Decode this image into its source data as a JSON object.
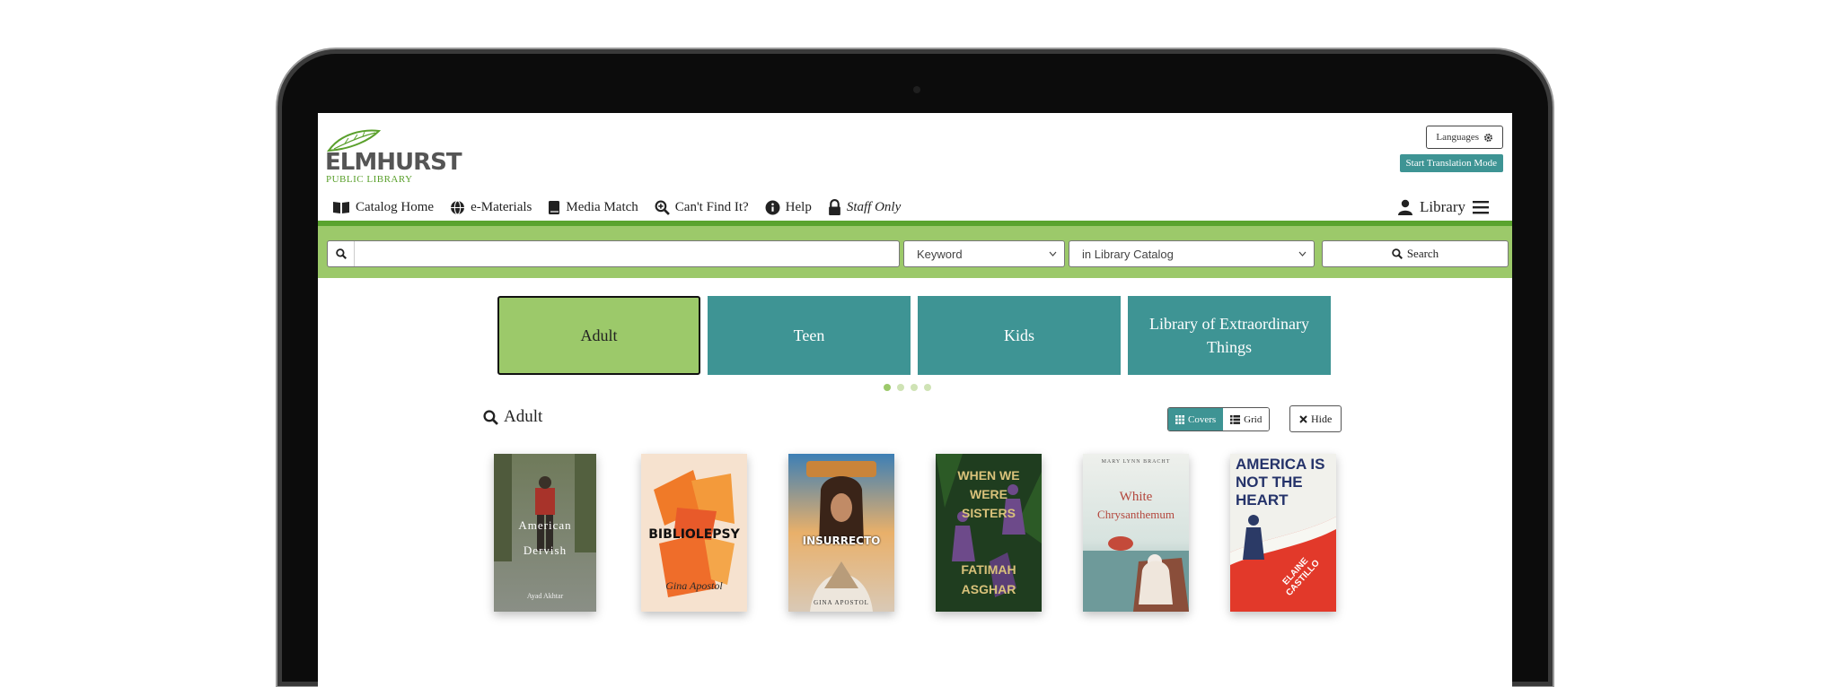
{
  "header": {
    "logo_main": "ELMHURST",
    "logo_sub": "PUBLIC LIBRARY",
    "languages_label": "Languages",
    "translation_label": "Start Translation Mode"
  },
  "nav": {
    "items": [
      {
        "label": "Catalog Home",
        "icon": "book-open-icon"
      },
      {
        "label": "e-Materials",
        "icon": "globe-icon"
      },
      {
        "label": "Media Match",
        "icon": "book-icon"
      },
      {
        "label": "Can't Find It?",
        "icon": "search-plus-icon"
      },
      {
        "label": "Help",
        "icon": "info-icon"
      },
      {
        "label": "Staff Only",
        "icon": "lock-icon"
      }
    ],
    "account_label": "Library"
  },
  "search": {
    "placeholder": "",
    "type_selected": "Keyword",
    "scope_selected": "in Library Catalog",
    "button_label": "Search"
  },
  "tiles": [
    {
      "label": "Adult",
      "active": true
    },
    {
      "label": "Teen",
      "active": false
    },
    {
      "label": "Kids",
      "active": false
    },
    {
      "label": "Library of Extraordinary Things",
      "active": false
    }
  ],
  "results": {
    "title": "Adult",
    "covers_label": "Covers",
    "grid_label": "Grid",
    "hide_label": "Hide"
  },
  "books": [
    {
      "title_line1": "American",
      "title_line2": "Dervish",
      "author": "Ayad Akhtar"
    },
    {
      "title_line1": "BIBLIOLEPSY",
      "title_line2": "",
      "author": "Gina Apostol"
    },
    {
      "title_line1": "INSURRECTO",
      "title_line2": "",
      "author": "GINA APOSTOL"
    },
    {
      "title_line1": "WHEN WE WERE SISTERS",
      "title_line2": "FATIMAH ASGHAR",
      "author": ""
    },
    {
      "title_line1": "White",
      "title_line2": "Chrysanthemum",
      "author": "MARY LYNN BRACHT"
    },
    {
      "title_line1": "AMERICA IS NOT THE HEART",
      "title_line2": "",
      "author": "ELAINE CASTILLO"
    }
  ],
  "colors": {
    "brand_green": "#9cc96a",
    "dark_green": "#5aa32e",
    "teal": "#3e9494"
  }
}
